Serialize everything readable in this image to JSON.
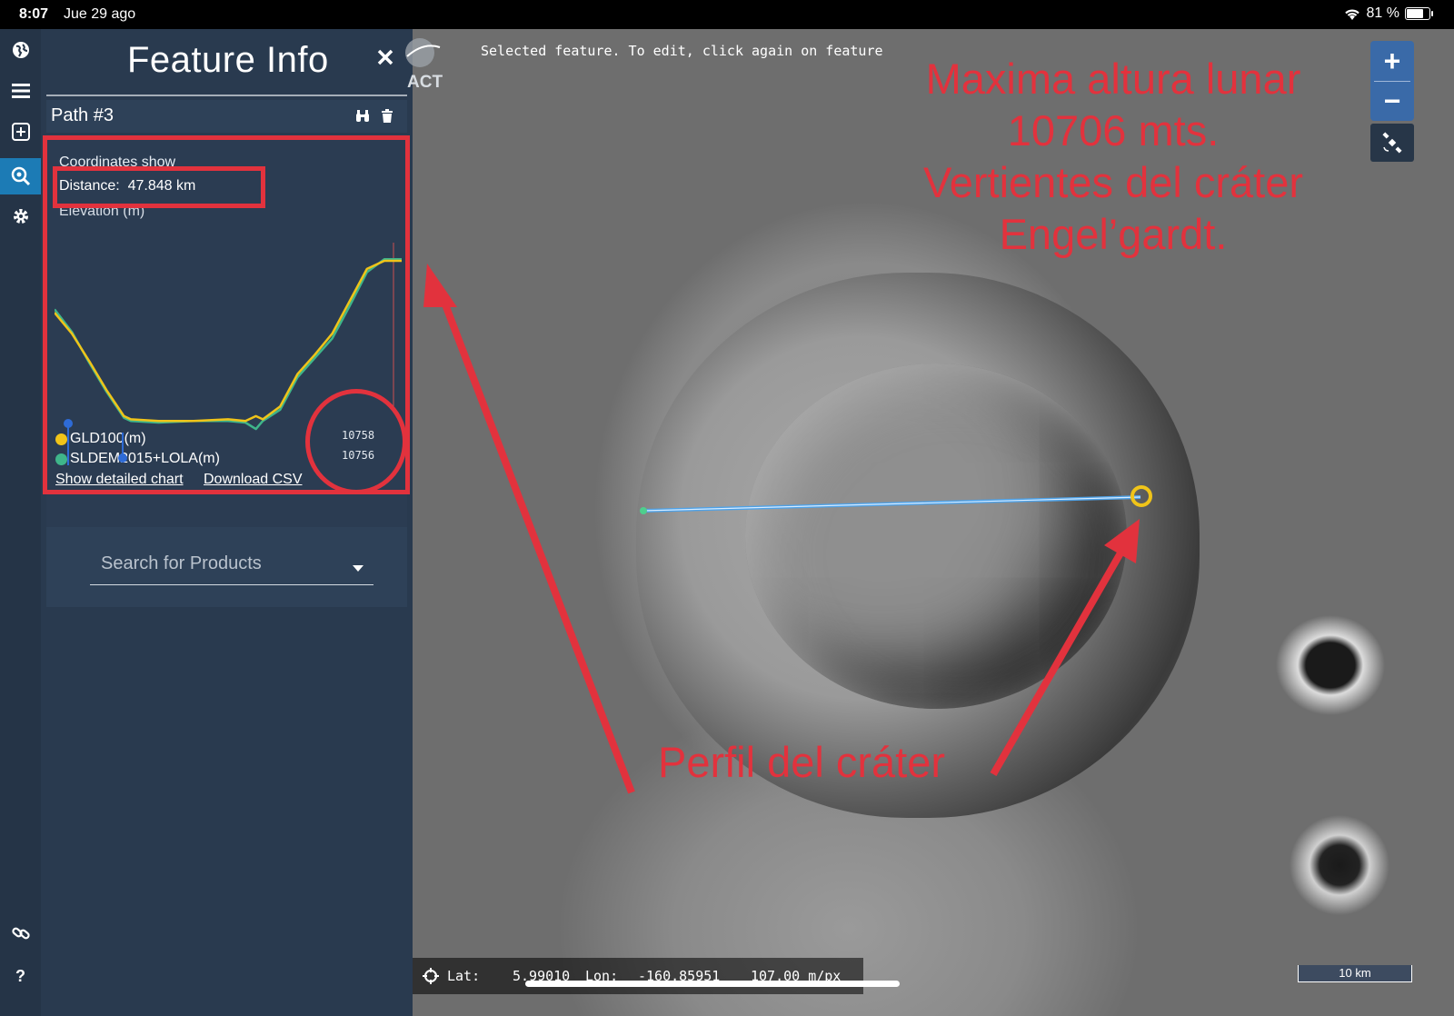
{
  "status_bar": {
    "time": "8:07",
    "date": "Jue 29 ago",
    "battery": "81 %",
    "battery_level": 0.81
  },
  "panel": {
    "title": "Feature Info",
    "path_name": "Path #3",
    "coordinates_label": "Coordinates show",
    "distance_label": "Distance:",
    "distance_value": "47.848 km",
    "elevation_label": "Elevation (m)",
    "legend": [
      {
        "name": "GLD100(m)",
        "color": "#f0c419"
      },
      {
        "name": "SLDEM2015+LOLA(m)",
        "color": "#3fb58a"
      }
    ],
    "readout_1": "10758",
    "readout_2": "10756",
    "show_chart_link": "Show detailed chart",
    "download_link": "Download CSV",
    "search_placeholder": "Search for Products"
  },
  "chart_data": {
    "type": "line",
    "x_label": "",
    "y_label": "Elevation (m)",
    "series": [
      {
        "name": "GLD100(m)",
        "color": "#f0c419",
        "x": [
          0,
          0.05,
          0.1,
          0.15,
          0.2,
          0.22,
          0.3,
          0.4,
          0.5,
          0.55,
          0.58,
          0.6,
          0.65,
          0.7,
          0.75,
          0.8,
          0.85,
          0.9,
          0.95,
          1.0
        ],
        "y": [
          0.68,
          0.55,
          0.38,
          0.2,
          0.04,
          0.02,
          0.01,
          0.01,
          0.02,
          0.01,
          0.04,
          0.02,
          0.1,
          0.3,
          0.42,
          0.55,
          0.75,
          0.95,
          1.0,
          1.0
        ]
      },
      {
        "name": "SLDEM2015+LOLA(m)",
        "color": "#3fb58a",
        "x": [
          0,
          0.05,
          0.1,
          0.15,
          0.2,
          0.22,
          0.3,
          0.4,
          0.5,
          0.55,
          0.58,
          0.6,
          0.65,
          0.7,
          0.75,
          0.8,
          0.85,
          0.9,
          0.95,
          1.0
        ],
        "y": [
          0.7,
          0.56,
          0.37,
          0.19,
          0.03,
          0.01,
          0.0,
          0.01,
          0.01,
          0.0,
          -0.04,
          0.01,
          0.08,
          0.28,
          0.4,
          0.52,
          0.72,
          0.93,
          1.01,
          1.01
        ]
      }
    ]
  },
  "map": {
    "message": "Selected feature. To edit, click again on feature",
    "logo_text": "ACT",
    "annotation_top": [
      "Maxima altura lunar",
      "10706 mts.",
      "Vertientes del cráter",
      "Engel’gardt."
    ],
    "annotation_bottom": "Perfil del cráter",
    "zoom_in": "+",
    "zoom_out": "−",
    "coords": {
      "lat_label": "Lat:",
      "lat": "5.99010",
      "lon_label": "Lon:",
      "lon": "-160.85951",
      "res": "107.00 m/px"
    },
    "scale_label": "10 km",
    "accent": "#e2323d"
  }
}
